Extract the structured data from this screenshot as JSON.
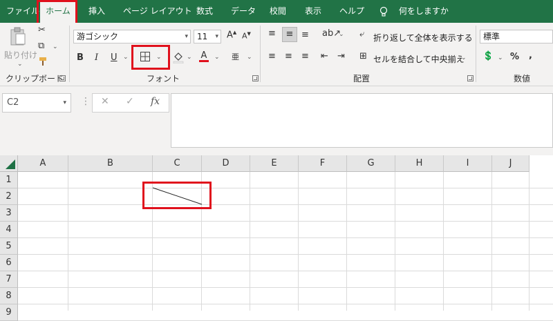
{
  "tabs": [
    {
      "label": "ファイル"
    },
    {
      "label": "ホーム",
      "active": true
    },
    {
      "label": "挿入"
    },
    {
      "label": "ページ レイアウト"
    },
    {
      "label": "数式"
    },
    {
      "label": "データ"
    },
    {
      "label": "校閲"
    },
    {
      "label": "表示"
    },
    {
      "label": "ヘルプ"
    }
  ],
  "tell_me": {
    "label": "何をしますか"
  },
  "ribbon": {
    "clipboard": {
      "label": "クリップボード",
      "paste_label": "貼り付け"
    },
    "font": {
      "label": "フォント",
      "font_name": "游ゴシック",
      "font_size": "11",
      "bold": "B",
      "italic": "I",
      "underline": "U",
      "grow": "A",
      "shrink": "A",
      "font_color": "A"
    },
    "alignment": {
      "label": "配置",
      "wrap_text": "折り返して全体を表示する",
      "merge_center": "セルを結合して中央揃え"
    },
    "number": {
      "label": "数値",
      "format": "標準",
      "percent": "%",
      "comma": ","
    }
  },
  "formula_bar": {
    "name_box": "C2",
    "cancel": "✕",
    "enter": "✓",
    "fx": "fx",
    "value": ""
  },
  "columns": [
    "A",
    "B",
    "C",
    "D",
    "E",
    "F",
    "G",
    "H",
    "I",
    "J"
  ],
  "rows": [
    "1",
    "2",
    "3",
    "4",
    "5",
    "6",
    "7",
    "8",
    "9"
  ],
  "colors": {
    "accent": "#217346",
    "highlight": "#e0101c",
    "font_color_bar": "#e0101c"
  }
}
